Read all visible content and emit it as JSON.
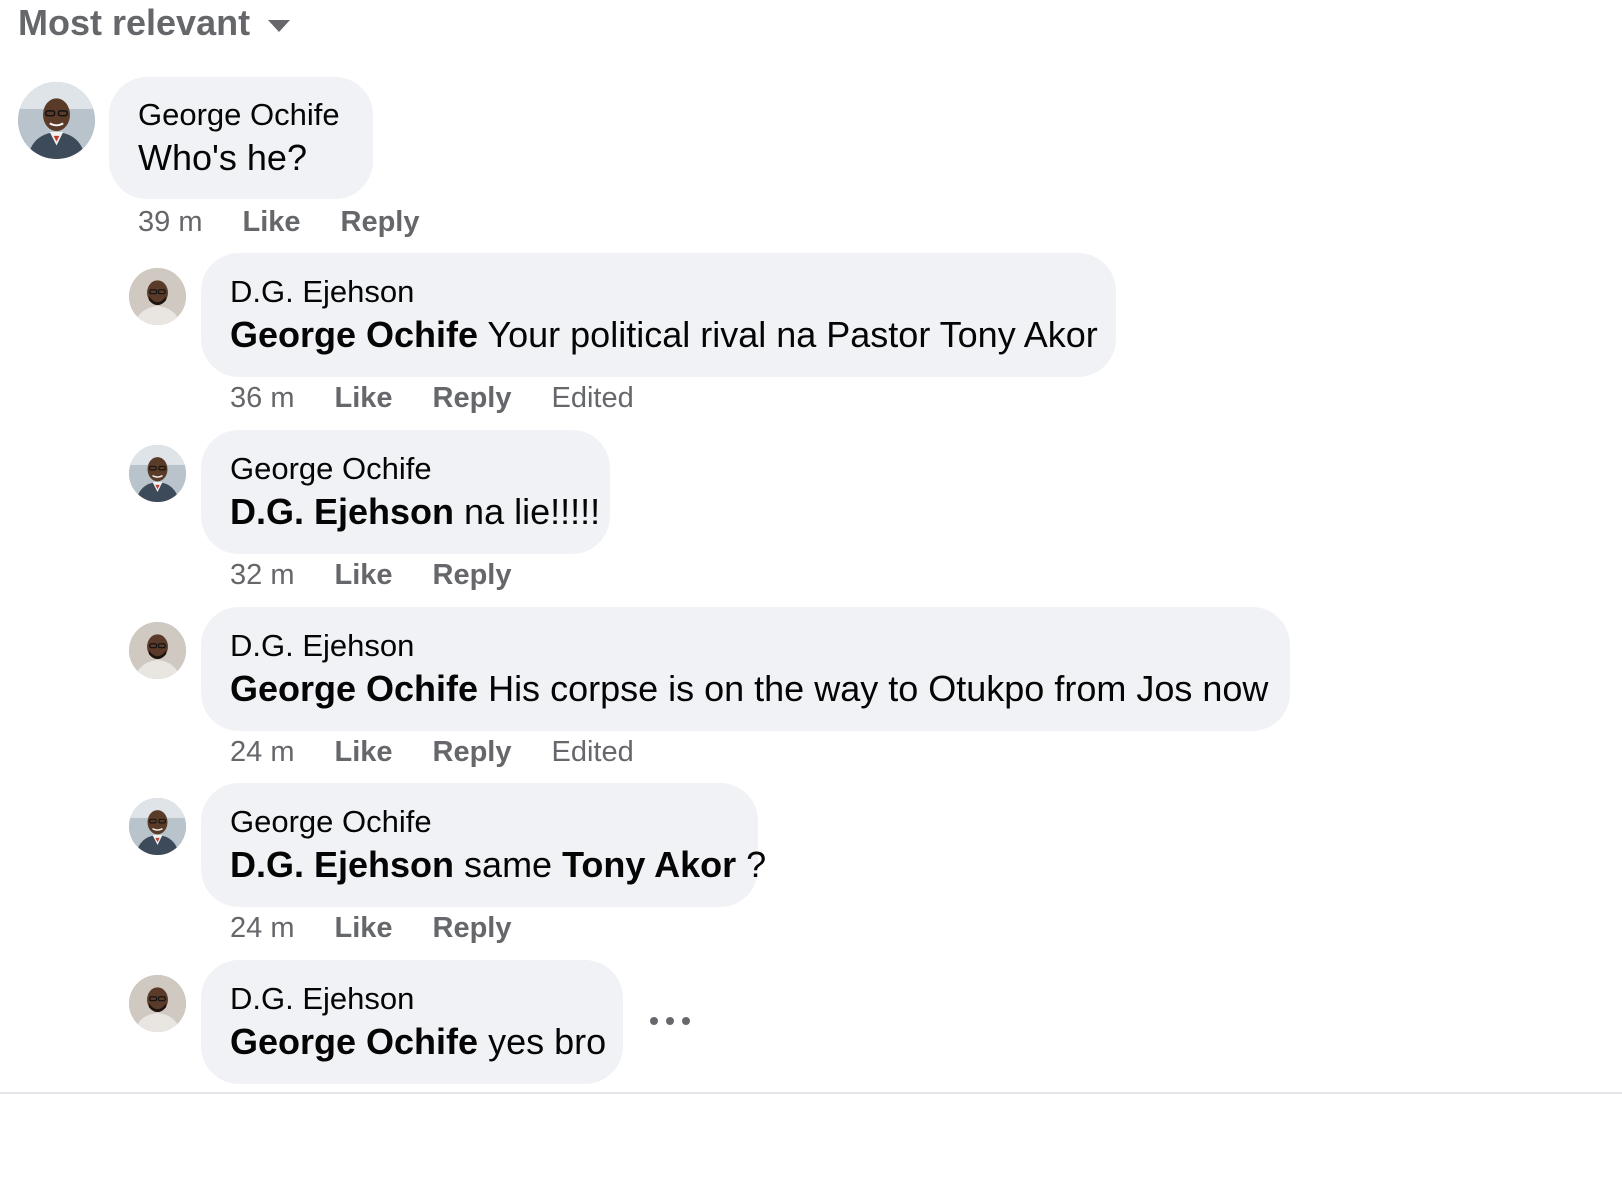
{
  "sort": {
    "label": "Most relevant"
  },
  "comments": [
    {
      "author": "George Ochife",
      "mention": "",
      "text": "Who's he?",
      "mention2": "",
      "text2": "",
      "time": "39 m",
      "like": "Like",
      "reply": "Reply",
      "edited": ""
    },
    {
      "author": "D.G. Ejehson",
      "mention": "George Ochife",
      "text": " Your political rival na Pastor Tony Akor",
      "mention2": "",
      "text2": "",
      "time": "36 m",
      "like": "Like",
      "reply": "Reply",
      "edited": "Edited"
    },
    {
      "author": "George Ochife",
      "mention": "D.G. Ejehson",
      "text": " na lie!!!!!",
      "mention2": "",
      "text2": "",
      "time": "32 m",
      "like": "Like",
      "reply": "Reply",
      "edited": ""
    },
    {
      "author": "D.G. Ejehson",
      "mention": "George Ochife",
      "text": " His corpse is on the way to Otukpo from Jos now",
      "mention2": "",
      "text2": "",
      "time": "24 m",
      "like": "Like",
      "reply": "Reply",
      "edited": "Edited"
    },
    {
      "author": "George Ochife",
      "mention": "D.G. Ejehson",
      "text": " same ",
      "mention2": "Tony Akor",
      "text2": " ?",
      "time": "24 m",
      "like": "Like",
      "reply": "Reply",
      "edited": ""
    },
    {
      "author": "D.G. Ejehson",
      "mention": "George Ochife",
      "text": " yes bro",
      "mention2": "",
      "text2": "",
      "time": "",
      "like": "",
      "reply": "",
      "edited": ""
    }
  ],
  "icons": {
    "sort_caret": "caret-down-icon",
    "more": "more-horizontal-icon"
  },
  "colors": {
    "bubble": "#f0f2f5",
    "secondary_text": "#65676b",
    "primary_text": "#050505"
  }
}
